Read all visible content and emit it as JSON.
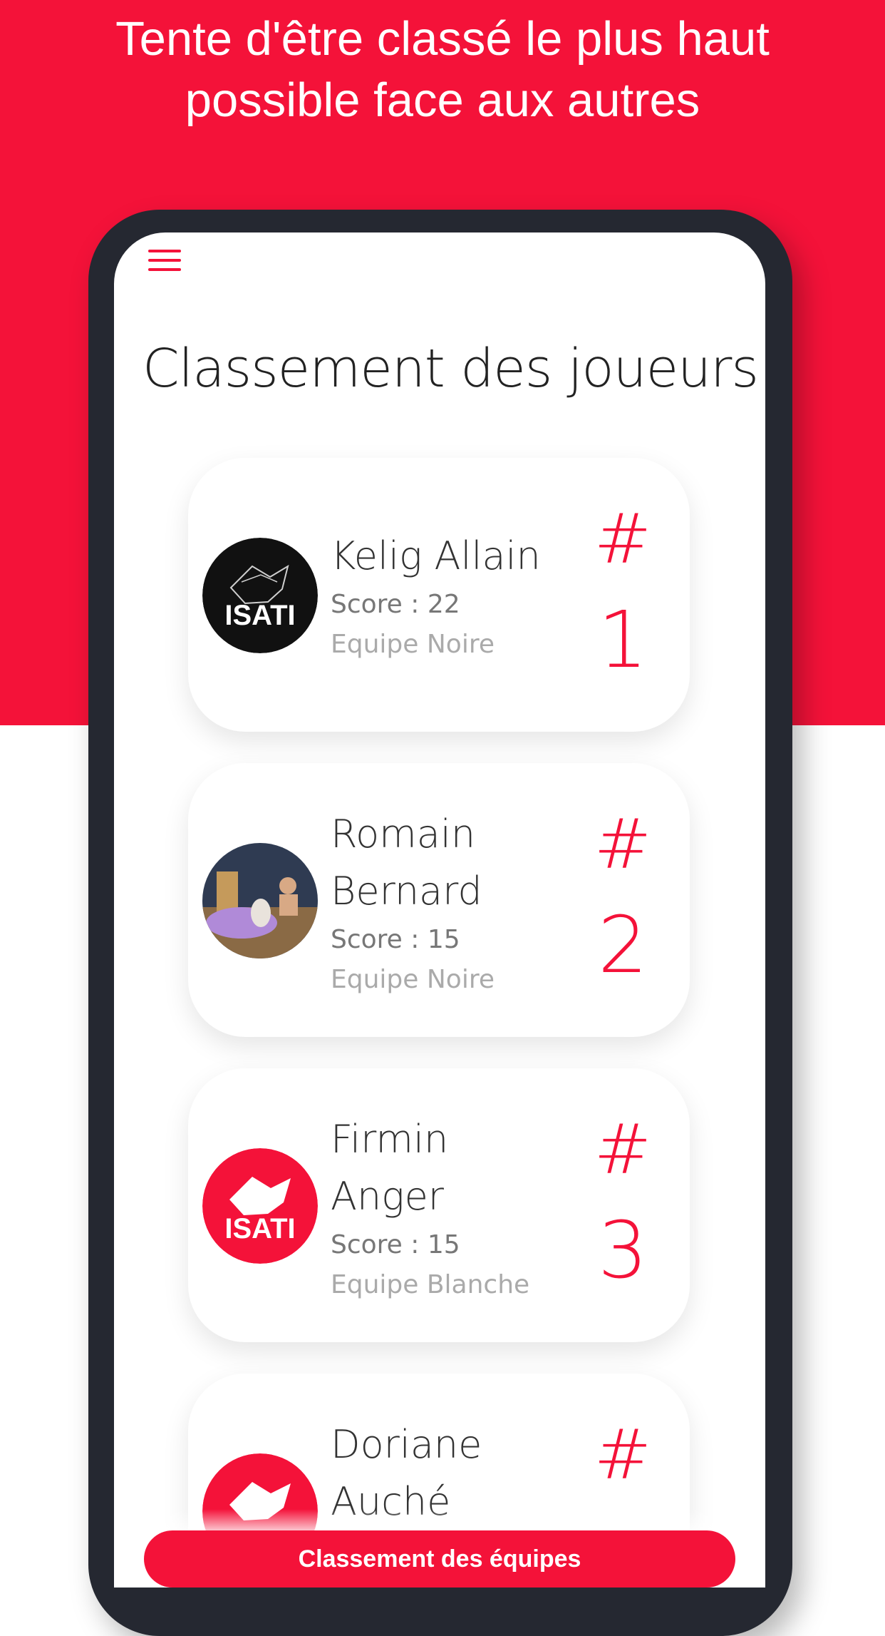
{
  "header": {
    "headline_line1": "Tente d'être classé le plus haut",
    "headline_line2": "possible face aux autres"
  },
  "app": {
    "page_title": "Classement des joueurs",
    "menu_icon": "hamburger-menu-icon"
  },
  "players": [
    {
      "name": "Kelig Allain",
      "score": "Score : 22",
      "team": "Equipe Noire",
      "hash": "#",
      "rank": "1",
      "avatar": "isati-black-logo"
    },
    {
      "name": "Romain Bernard",
      "score": "Score : 15",
      "team": "Equipe Noire",
      "hash": "#",
      "rank": "2",
      "avatar": "user-photo"
    },
    {
      "name": "Firmin Anger",
      "score": "Score : 15",
      "team": "Equipe Blanche",
      "hash": "#",
      "rank": "3",
      "avatar": "isati-red-logo"
    },
    {
      "name": "Doriane Auché",
      "hash": "#",
      "avatar": "isati-red-logo"
    }
  ],
  "footer": {
    "button_label": "Classement des équipes"
  },
  "colors": {
    "accent": "#f41239",
    "phone_frame": "#252831"
  }
}
